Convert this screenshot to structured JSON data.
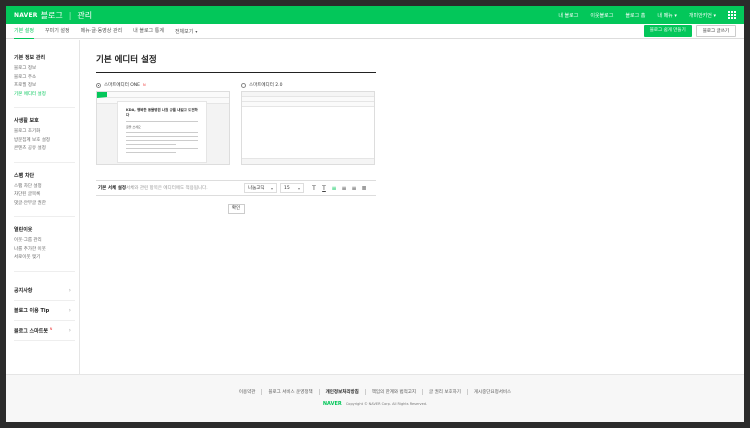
{
  "topbar": {
    "brand": "NAVER",
    "service": "블로그",
    "section": "관리",
    "links": [
      "내 블로그",
      "이웃블로그",
      "블로그 홈",
      "내 메뉴",
      "개미안키언"
    ]
  },
  "tabs": [
    {
      "label": "기본 설정",
      "active": true
    },
    {
      "label": "꾸미기 설정",
      "active": false
    },
    {
      "label": "메뉴·글·동영상 관리",
      "active": false
    },
    {
      "label": "내 블로그 통계",
      "active": false
    },
    {
      "label": "전체보기",
      "active": false
    }
  ],
  "tab_buttons": {
    "create": "블로그 쉽게 만들기",
    "view": "블로그 글쓰기"
  },
  "sidebar": {
    "groups": [
      {
        "title": "기본 정보 관리",
        "items": [
          "블로그 정보",
          "블로그 주소",
          "프로필 정보",
          "기본 에디터 설정"
        ],
        "active_index": 3
      },
      {
        "title": "사생활 보호",
        "items": [
          "블로그 초기화",
          "방문집계 보호 설정",
          "콘텐츠 공유 설정"
        ]
      },
      {
        "title": "스팸 차단",
        "items": [
          "스팸 차단 설정",
          "차단된 글목록",
          "댓글·안부글 권한"
        ]
      },
      {
        "title": "열린이웃",
        "items": [
          "이웃·그룹 관리",
          "나를 추가한 이웃",
          "서로이웃 맺기"
        ]
      }
    ],
    "rows": [
      {
        "label": "공지사항",
        "new": false
      },
      {
        "label": "블로그 이용 Tip",
        "new": false
      },
      {
        "label": "블로그 스마트봇",
        "new": true
      }
    ],
    "new_mark": "N"
  },
  "main": {
    "title": "기본 에디터 설정",
    "editor_one": {
      "label": "스마트에디터 ONE",
      "selected": true,
      "preview_title": "KDA, 행복한 동물병원 나원 \n규를 내걸고 도전하다",
      "preview_sub": "글을 쓰세요"
    },
    "editor_two": {
      "label": "스마트에디터 2.0",
      "selected": false
    },
    "font_setting": {
      "label": "기본 서체 설정",
      "description": "서체와 관련 항목은 에디터에도 적용됩니다.",
      "font": "나눔고딕",
      "size": "15"
    },
    "confirm_button": "확인"
  },
  "footer": {
    "links": [
      "이용약관",
      "블로그 서비스 운영정책",
      "개인정보처리방침",
      "책임의 한계와 법적고지",
      "글 권리 보호하기",
      "게시중단요청서비스"
    ],
    "bold_index": 2,
    "copyright_logo": "NAVER",
    "copyright": "Copyright © NAVER Corp. All Rights Reserved."
  },
  "colors": {
    "brand": "#03c75a",
    "accent_new": "#e33333"
  }
}
